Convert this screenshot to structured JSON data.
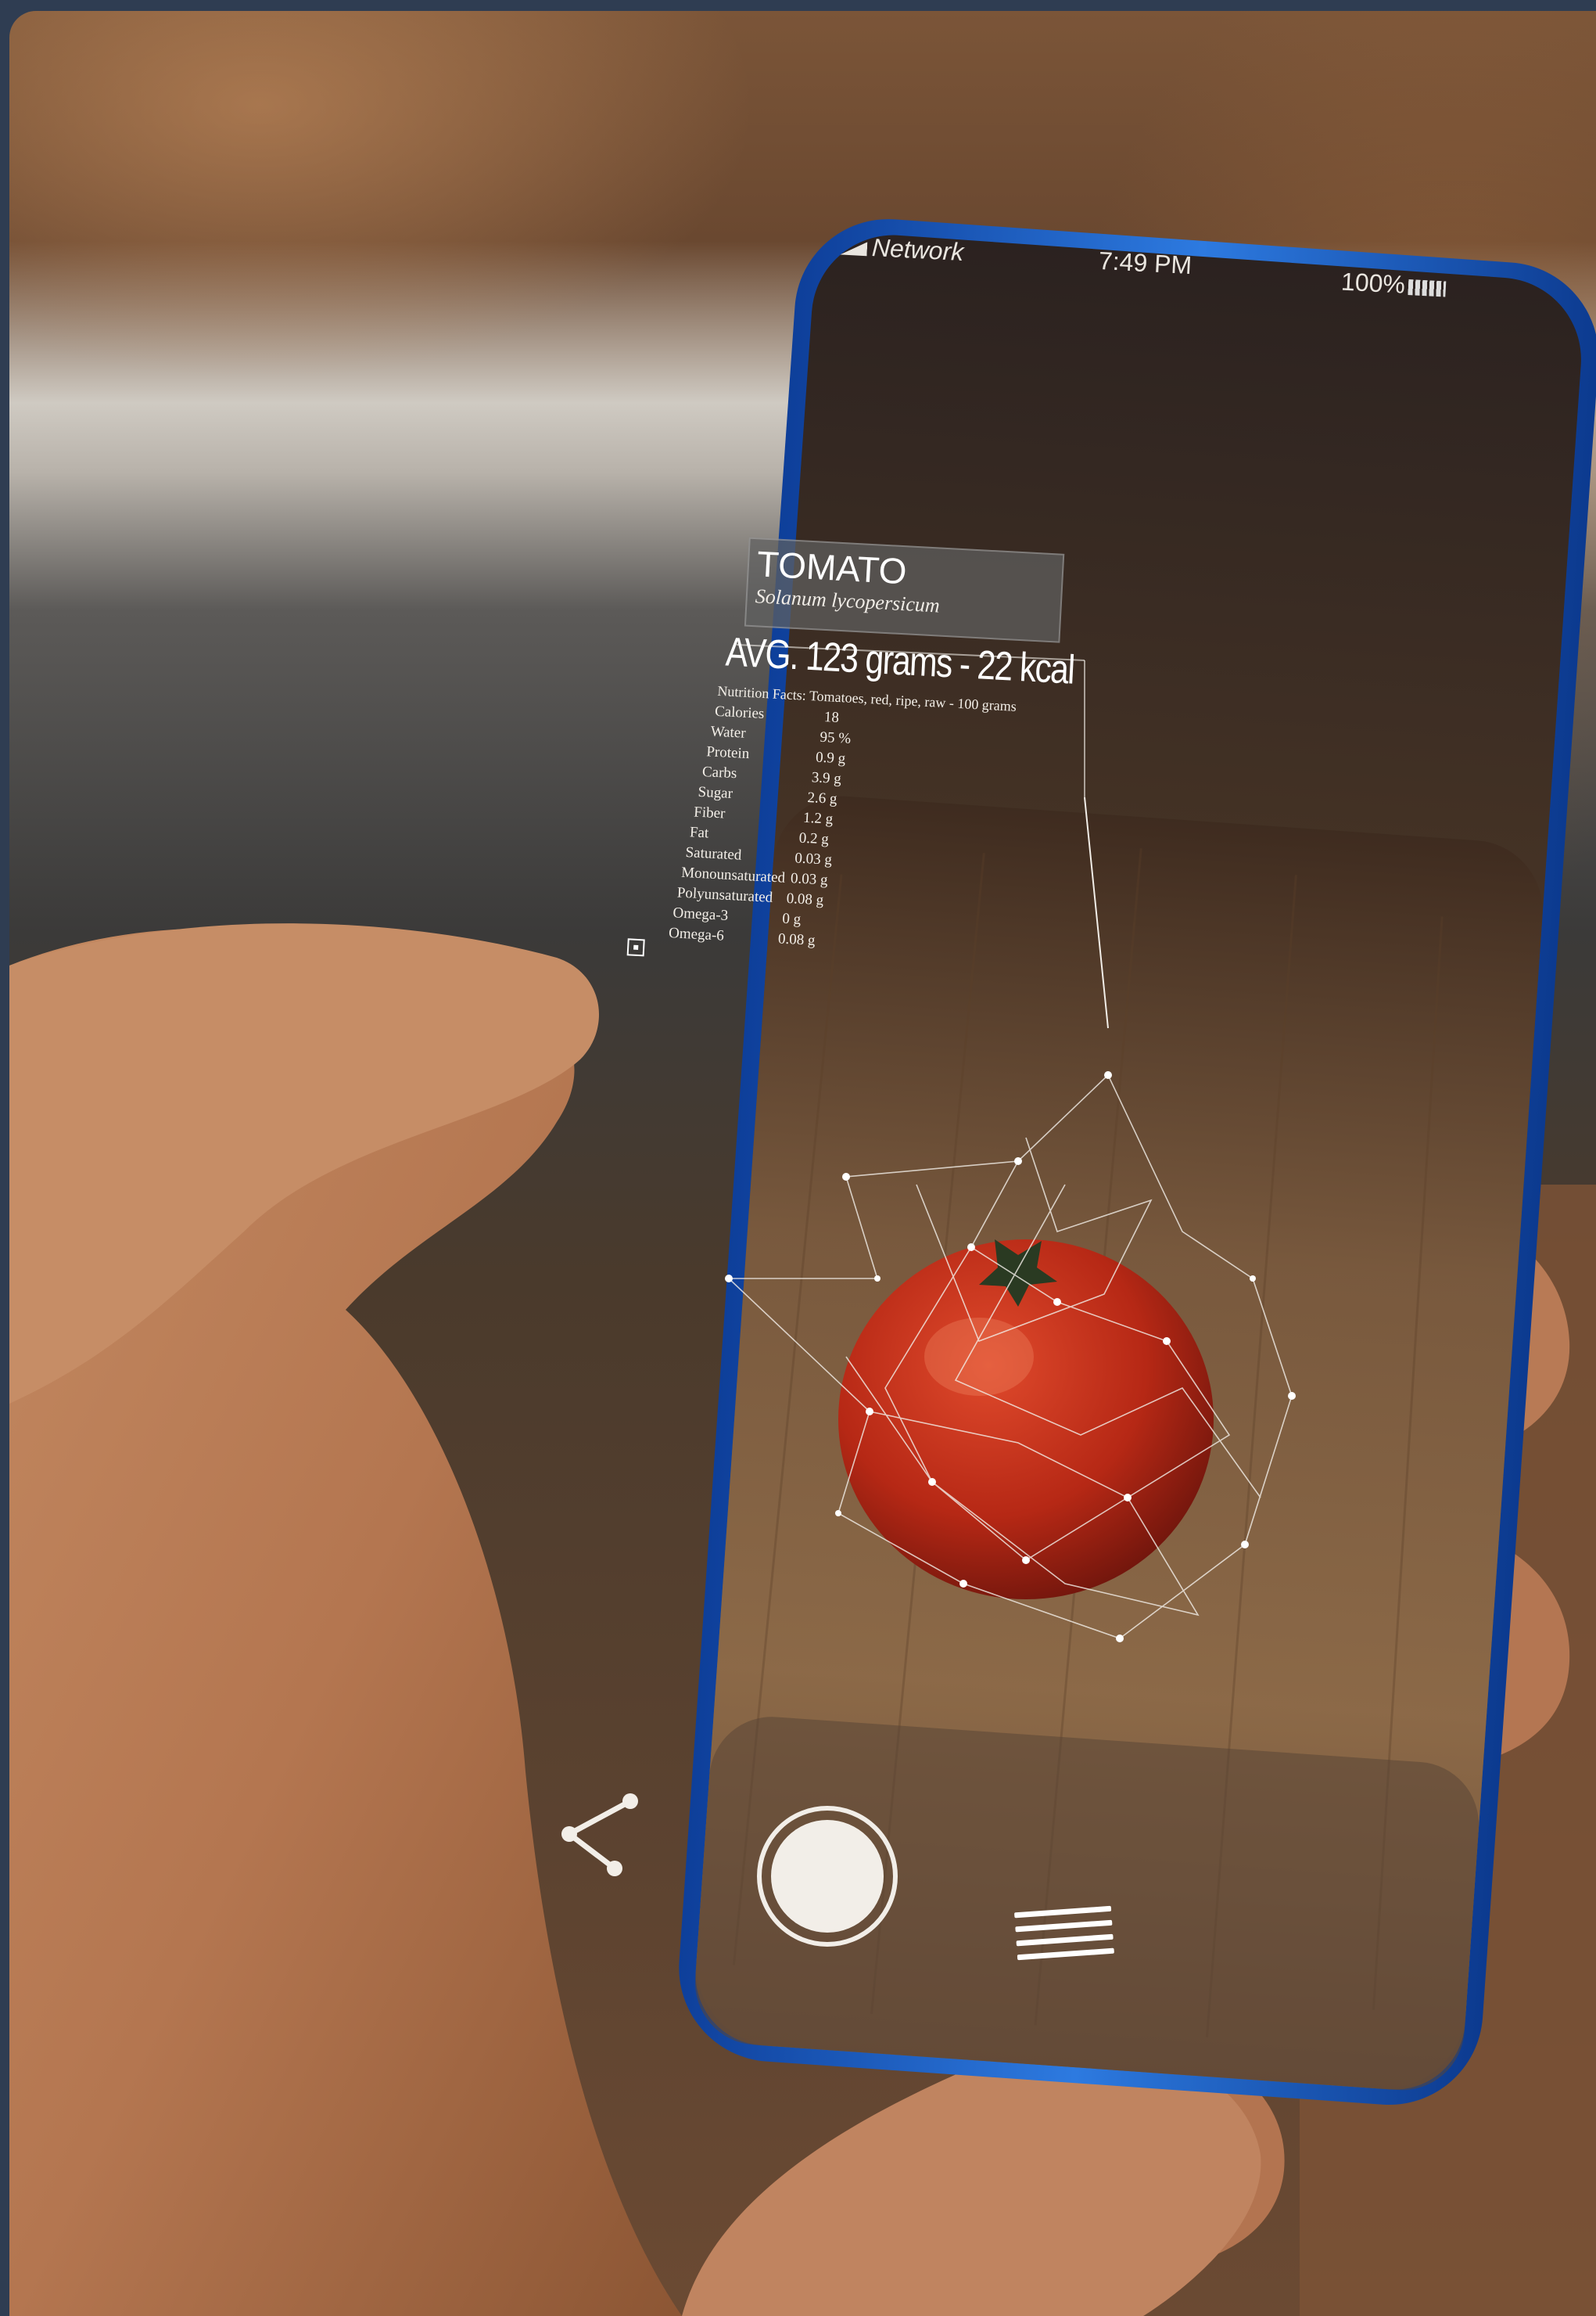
{
  "status_bar": {
    "network": "Network",
    "time": "7:49 PM",
    "battery": "100%"
  },
  "food": {
    "name": "TOMATO",
    "latin": "Solanum lycopersicum",
    "average": "AVG. 123 grams - 22 kcal",
    "facts_caption": "Nutrition Facts: Tomatoes, red, ripe, raw - 100 grams",
    "nutrients": [
      {
        "label": "Calories",
        "value": "18"
      },
      {
        "label": "Water",
        "value": "95 %"
      },
      {
        "label": "Protein",
        "value": "0.9 g"
      },
      {
        "label": "Carbs",
        "value": "3.9 g"
      },
      {
        "label": "Sugar",
        "value": "2.6 g"
      },
      {
        "label": "Fiber",
        "value": "1.2 g"
      },
      {
        "label": "Fat",
        "value": "0.2 g"
      },
      {
        "label": "Saturated",
        "value": "0.03 g"
      },
      {
        "label": "Monounsaturated",
        "value": "0.03 g"
      },
      {
        "label": "Polyunsaturated",
        "value": "0.08 g"
      },
      {
        "label": "Omega-3",
        "value": "0 g"
      },
      {
        "label": "Omega-6",
        "value": "0.08 g"
      }
    ]
  },
  "icons": {
    "share": "share-icon",
    "shutter": "shutter-button",
    "menu": "menu-icon",
    "signal": "signal-icon",
    "battery": "battery-icon"
  },
  "colors": {
    "frame": "#2f3d52",
    "phone_body": "#1f5fc4",
    "tomato": "#c2311c"
  }
}
